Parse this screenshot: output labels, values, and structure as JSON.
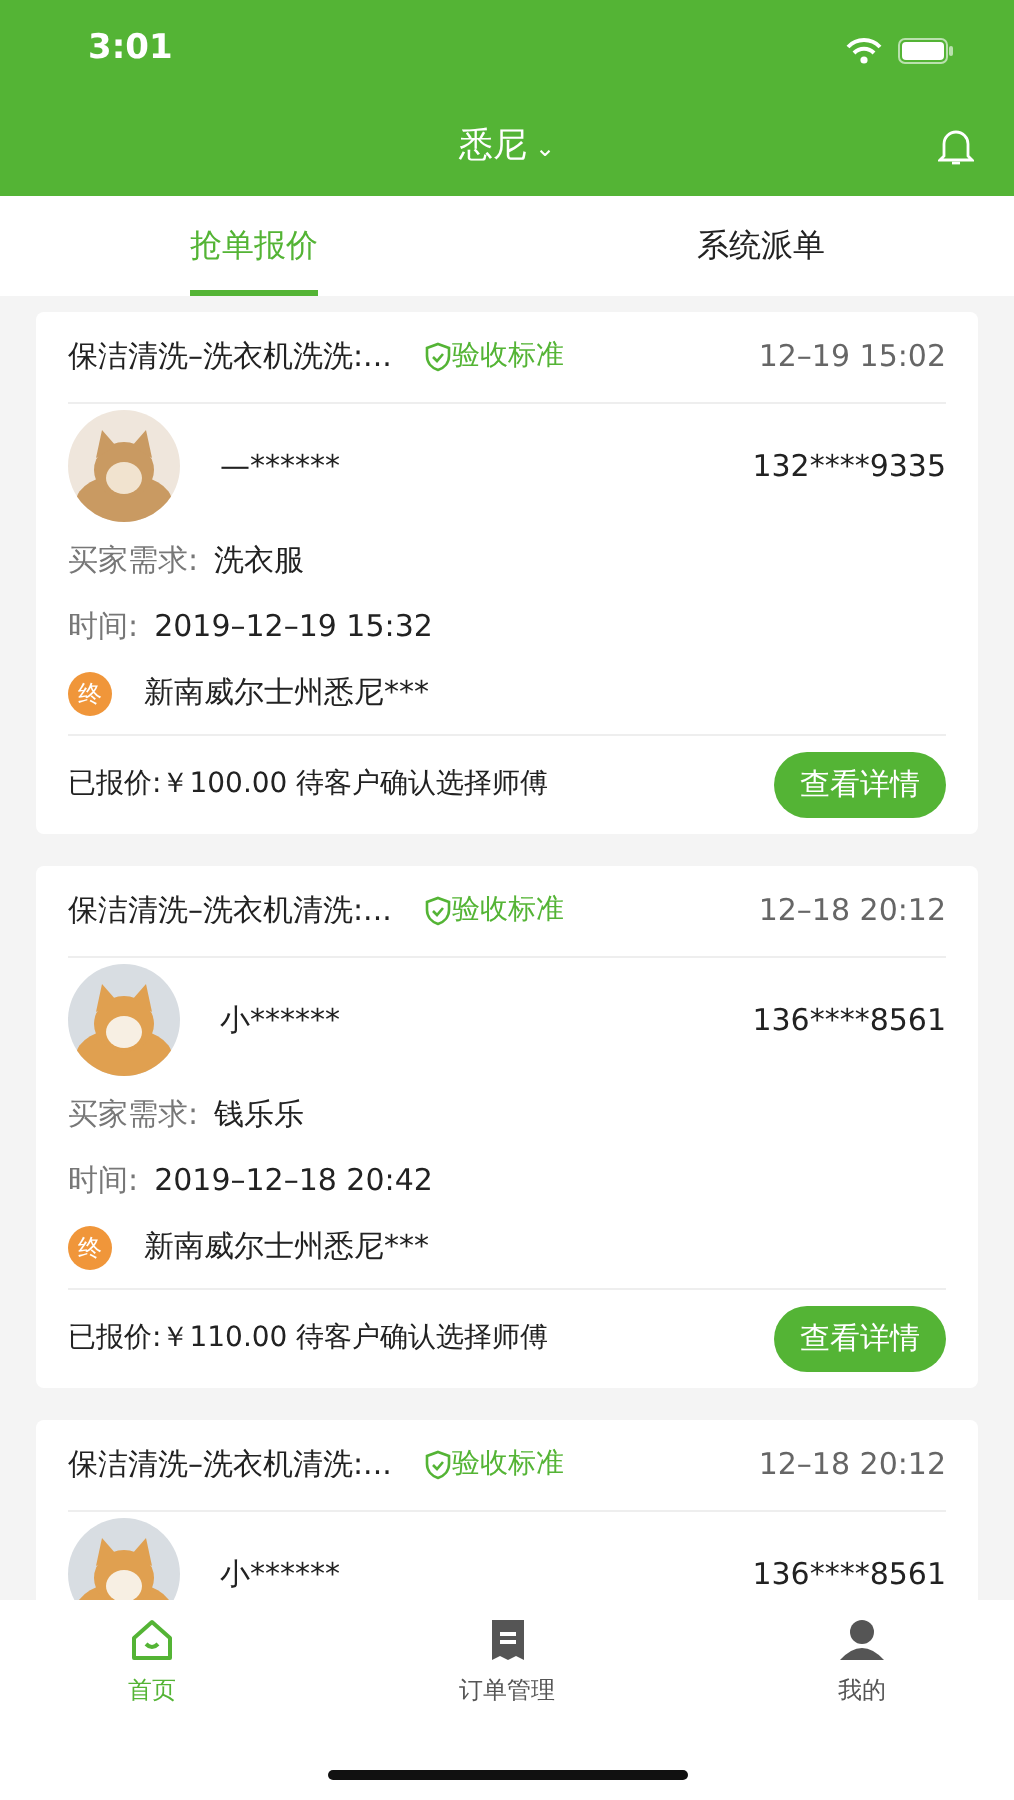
{
  "status_bar": {
    "time": "3:01"
  },
  "header": {
    "city": "悉尼",
    "dropdown_glyph": "⌄"
  },
  "tabs": [
    {
      "label": "抢单报价",
      "selected": true
    },
    {
      "label": "系统派单",
      "selected": false
    }
  ],
  "orders": [
    {
      "title": "保洁清洗–洗衣机洗洗:...",
      "standard": "验收标准",
      "date": "12–19 15:02",
      "name": "—******",
      "phone": "132****9335",
      "demand_label": "买家需求:",
      "demand": "洗衣服",
      "time_label": "时间:",
      "time": "2019–12–19 15:32",
      "end_badge": "终",
      "address": "新南威尔士州悉尼***",
      "quote": "已报价:￥100.00 待客户确认选择师傅",
      "button": "查看详情"
    },
    {
      "title": "保洁清洗–洗衣机清洗:...",
      "standard": "验收标准",
      "date": "12–18 20:12",
      "name": "小******",
      "phone": "136****8561",
      "demand_label": "买家需求:",
      "demand": "钱乐乐",
      "time_label": "时间:",
      "time": "2019–12–18 20:42",
      "end_badge": "终",
      "address": "新南威尔士州悉尼***",
      "quote": "已报价:￥110.00 待客户确认选择师傅",
      "button": "查看详情"
    },
    {
      "title": "保洁清洗–洗衣机清洗:...",
      "standard": "验收标准",
      "date": "12–18 20:12",
      "name": "小******",
      "phone": "136****8561"
    }
  ],
  "bottom_nav": [
    {
      "label": "首页",
      "selected": true
    },
    {
      "label": "订单管理",
      "selected": false
    },
    {
      "label": "我的",
      "selected": false
    }
  ]
}
